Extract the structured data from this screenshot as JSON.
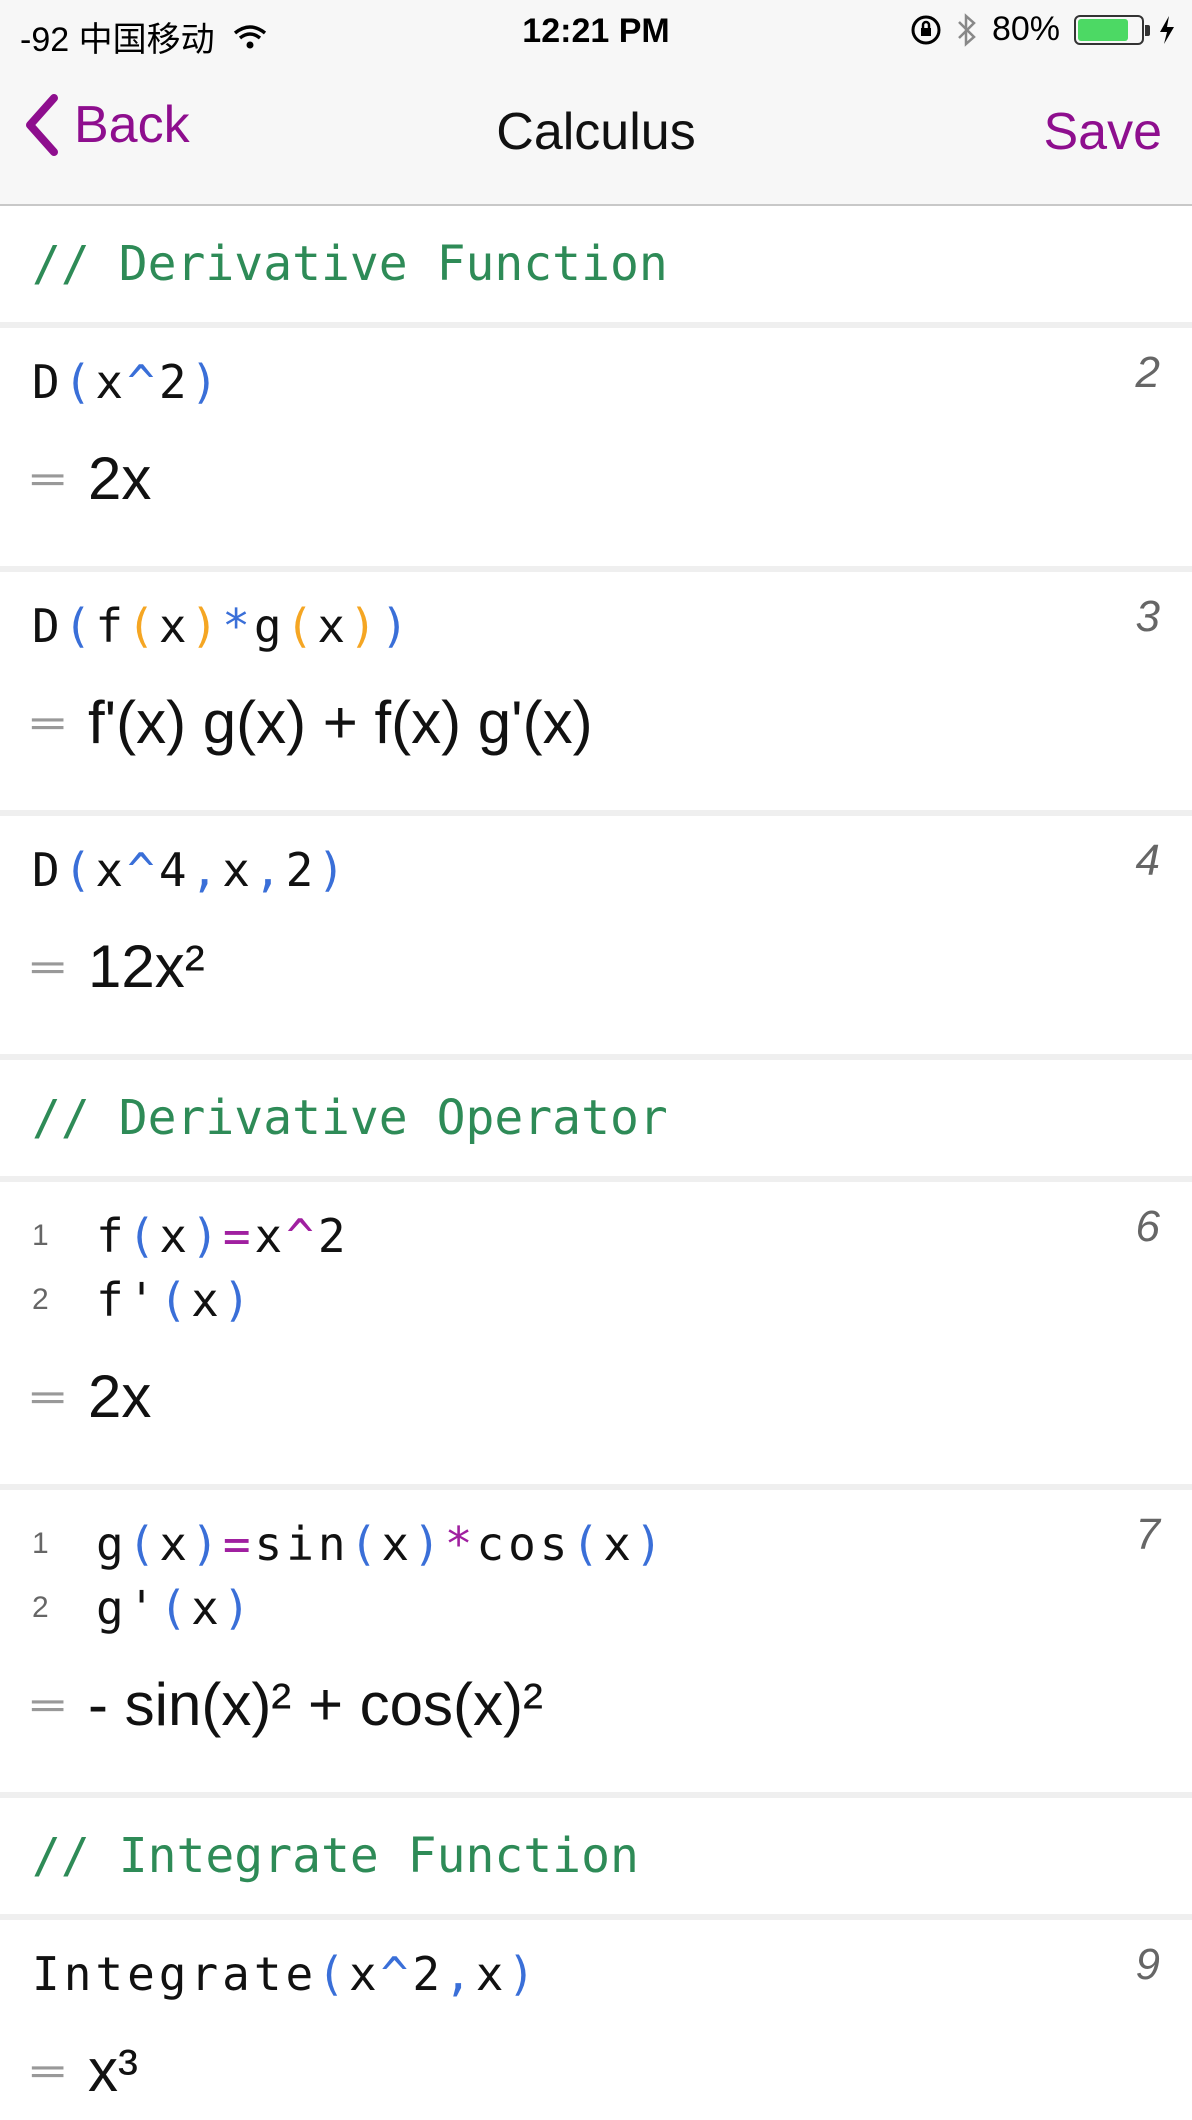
{
  "status_bar": {
    "signal": "-92 中国移动",
    "time": "12:21 PM",
    "battery_percent": "80%",
    "battery_level": 0.8,
    "icons": [
      "wifi-icon",
      "orientation-lock-icon",
      "bluetooth-icon",
      "battery-icon",
      "charging-icon"
    ]
  },
  "nav": {
    "back_label": "Back",
    "title": "Calculus",
    "save_label": "Save"
  },
  "colors": {
    "accent": "#8e0e8e",
    "comment": "#2e8b57",
    "paren": "#3a6fd8",
    "inner_paren": "#f5a623",
    "operator": "#a020a0"
  },
  "cells": {
    "c1": {
      "comment": "// Derivative Function"
    },
    "c2": {
      "num": "2",
      "code": [
        "D",
        "(",
        "x",
        "^",
        "2",
        ")"
      ],
      "result": "2x"
    },
    "c3": {
      "num": "3",
      "code": [
        "D",
        "(",
        "f",
        "(",
        "x",
        ")",
        "*",
        "g",
        "(",
        "x",
        ")",
        ")"
      ],
      "result": "f'(x) g(x) + f(x) g'(x)"
    },
    "c4": {
      "num": "4",
      "code": [
        "D",
        "(",
        "x",
        "^",
        "4",
        ",",
        "x",
        ",",
        "2",
        ")"
      ],
      "result": "12x²"
    },
    "c5": {
      "comment": "// Derivative Operator"
    },
    "c6": {
      "num": "6",
      "lines": [
        {
          "ln": "1",
          "code": [
            "f",
            "(",
            "x",
            ")",
            "=",
            "x",
            "^",
            "2"
          ]
        },
        {
          "ln": "2",
          "code": [
            "f'",
            "(",
            "x",
            ")"
          ]
        }
      ],
      "result": "2x"
    },
    "c7": {
      "num": "7",
      "lines": [
        {
          "ln": "1",
          "code": [
            "g",
            "(",
            "x",
            ")",
            "=",
            "sin",
            "(",
            "x",
            ")",
            "*",
            "cos",
            "(",
            "x",
            ")"
          ]
        },
        {
          "ln": "2",
          "code": [
            "g'",
            "(",
            "x",
            ")"
          ]
        }
      ],
      "result": "- sin(x)² + cos(x)²"
    },
    "c8": {
      "comment": "// Integrate Function"
    },
    "c9": {
      "num": "9",
      "code": [
        "Integrate",
        "(",
        "x",
        "^",
        "2",
        ",",
        "x",
        ")"
      ],
      "result": "x³"
    }
  }
}
